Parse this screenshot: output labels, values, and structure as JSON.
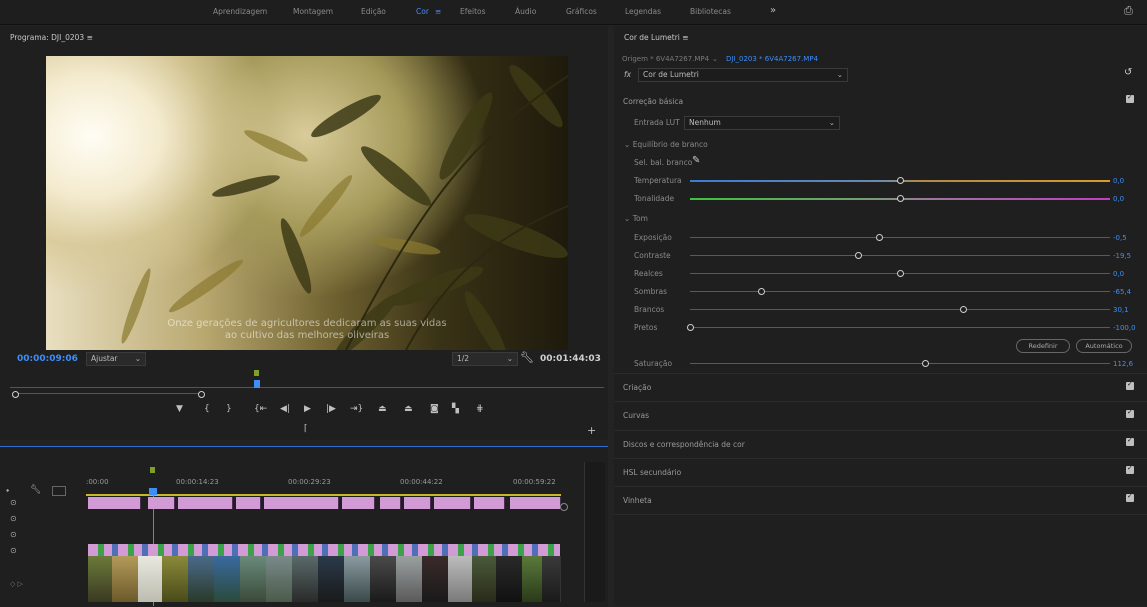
{
  "workspaces": [
    "Aprendizagem",
    "Montagem",
    "Edição",
    "Cor",
    "Efeitos",
    "Áudio",
    "Gráficos",
    "Legendas",
    "Bibliotecas"
  ],
  "active_workspace": "Cor",
  "overflow_glyph": "»",
  "program_monitor": {
    "title": "Programa: DJI_0203",
    "menu_glyph": "≡",
    "subtitle_line1": "Onze gerações de agricultores dedicaram as suas vidas",
    "subtitle_line2": "ao cultivo das melhores oliveiras",
    "current_timecode": "00:00:09:06",
    "fit_label": "Ajustar",
    "resolution": "1/2",
    "duration": "00:01:44:03"
  },
  "timeline": {
    "timecodes": [
      ":00:00",
      "00:00:14:23",
      "00:00:29:23",
      "00:00:44:22",
      "00:00:59:22"
    ]
  },
  "lumetri": {
    "title": "Cor de Lumetri",
    "menu_glyph": "≡",
    "source_label": "Origem * 6V4A7267.MP4",
    "sequence_label": "DJI_0203 * 6V4A7267.MP4",
    "fx_label": "fx",
    "effect_name": "Cor de Lumetri",
    "sections": {
      "basic": "Correção básica",
      "lut_label": "Entrada LUT",
      "lut_value": "Nenhum",
      "white_balance": "Equilíbrio de branco",
      "wb_selector": "Sel. bal. branco",
      "tone": "Tom",
      "reset": "Redefinir",
      "auto": "Automático"
    },
    "wb_sliders": [
      {
        "label": "Temperatura",
        "value": "0,0",
        "pos": 0.5
      },
      {
        "label": "Tonalidade",
        "value": "0,0",
        "pos": 0.5
      }
    ],
    "tone_sliders": [
      {
        "label": "Exposição",
        "value": "-0,5",
        "pos": 0.45
      },
      {
        "label": "Contraste",
        "value": "-19,5",
        "pos": 0.4
      },
      {
        "label": "Realces",
        "value": "0,0",
        "pos": 0.5
      },
      {
        "label": "Sombras",
        "value": "-65,4",
        "pos": 0.17
      },
      {
        "label": "Brancos",
        "value": "30,1",
        "pos": 0.65
      },
      {
        "label": "Pretos",
        "value": "-100,0",
        "pos": 0.0
      }
    ],
    "saturation": {
      "label": "Saturação",
      "value": "112,6",
      "pos": 0.56
    },
    "collapsed_sections": [
      "Criação",
      "Curvas",
      "Discos e correspondência de cor",
      "HSL secundário",
      "Vinheta"
    ]
  },
  "colors": {
    "accent": "#3e8ef7",
    "clip_pink": "#d29bd6",
    "temp_blue": "#3a7bd5",
    "temp_orange": "#d99a2b",
    "tint_green": "#3cc43c",
    "tint_magenta": "#c23cc2"
  }
}
